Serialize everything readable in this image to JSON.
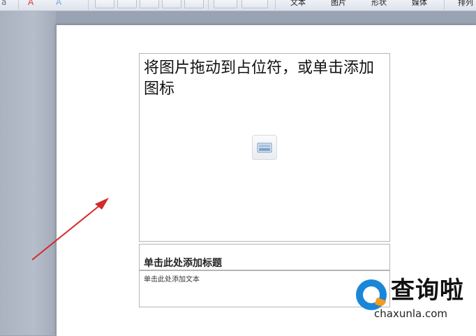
{
  "toolbar": {
    "groups": [
      {
        "label": "文本"
      },
      {
        "label": "图片"
      },
      {
        "label": "形状"
      },
      {
        "label": "媒体"
      },
      {
        "label": "排列"
      }
    ],
    "left_glyph": "a",
    "font_color_glyph": "A",
    "text_effect_glyph": "A"
  },
  "slide": {
    "picture_placeholder": "将图片拖动到占位符，或单击添加图标",
    "title_placeholder": "单击此处添加标题",
    "body_placeholder": "单击此处添加文本"
  },
  "watermark": {
    "name": "查询啦",
    "url": "chaxunla.com"
  },
  "colors": {
    "arrow": "#d42a2a",
    "watermark_blue": "#1a86d9",
    "watermark_orange": "#f59a1b"
  }
}
